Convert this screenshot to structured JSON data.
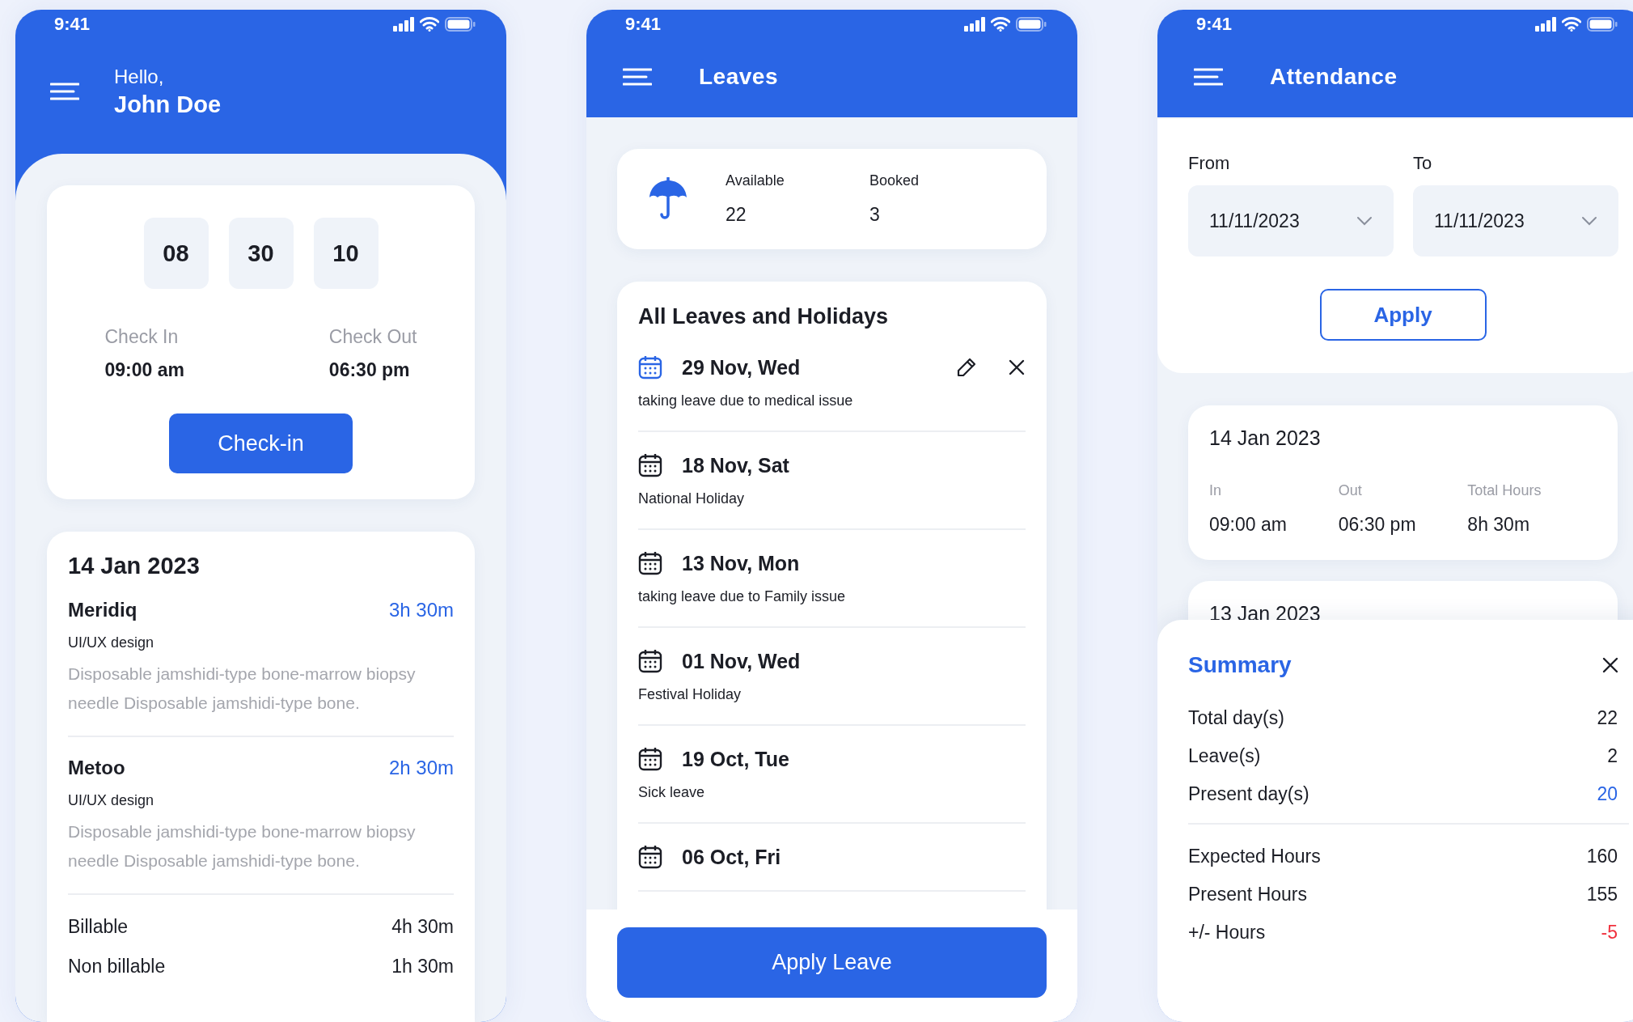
{
  "screens": [
    {
      "kind": "home",
      "status_time": "9:41",
      "greeting": "Hello,",
      "user_name": "John Doe",
      "timer": [
        "08",
        "30",
        "10"
      ],
      "check_in": {
        "label": "Check In",
        "time": "09:00 am"
      },
      "check_out": {
        "label": "Check Out",
        "time": "06:30 pm"
      },
      "button": "Check-in",
      "day": {
        "date": "14 Jan 2023",
        "projects": [
          {
            "name": "Meridiq",
            "hours": "3h 30m",
            "role": "UI/UX design",
            "description": "Disposable jamshidi-type bone-marrow biopsy needle Disposable jamshidi-type bone."
          },
          {
            "name": "Metoo",
            "hours": "2h 30m",
            "role": "UI/UX design",
            "description": "Disposable jamshidi-type bone-marrow biopsy needle Disposable jamshidi-type bone."
          }
        ],
        "totals": [
          {
            "label": "Billable",
            "value": "4h 30m"
          },
          {
            "label": "Non billable",
            "value": "1h 30m"
          }
        ]
      }
    },
    {
      "kind": "leaves",
      "status_time": "9:41",
      "title": "Leaves",
      "balance": [
        {
          "label": "Available",
          "value": "22"
        },
        {
          "label": "Booked",
          "value": "3"
        }
      ],
      "list_title": "All Leaves and Holidays",
      "leaves": [
        {
          "date": "29 Nov, Wed",
          "note": "taking leave due to  medical issue",
          "selected": true
        },
        {
          "date": "18 Nov, Sat",
          "note": "National Holiday",
          "selected": false
        },
        {
          "date": "13 Nov, Mon",
          "note": "taking leave due to  Family issue",
          "selected": false
        },
        {
          "date": "01 Nov, Wed",
          "note": "Festival Holiday",
          "selected": false
        },
        {
          "date": "19 Oct, Tue",
          "note": "Sick leave",
          "selected": false
        },
        {
          "date": "06 Oct, Fri",
          "selected": false
        }
      ],
      "button": "Apply Leave"
    },
    {
      "kind": "attendance",
      "status_time": "9:41",
      "title": "Attendance",
      "from": {
        "label": "From",
        "value": "11/11/2023"
      },
      "to": {
        "label": "To",
        "value": "11/11/2023"
      },
      "button": "Apply",
      "days": [
        {
          "date": "14 Jan 2023",
          "columns": [
            {
              "label": "In",
              "value": "09:00 am"
            },
            {
              "label": "Out",
              "value": "06:30 pm"
            },
            {
              "label": "Total Hours",
              "value": "8h 30m"
            }
          ]
        },
        {
          "date": "13 Jan 2023"
        }
      ],
      "summary": {
        "title": "Summary",
        "groups": [
          [
            {
              "label": "Total day(s)",
              "value": "22",
              "color": "#1b1d25"
            },
            {
              "label": "Leave(s)",
              "value": "2",
              "color": "#1b1d25"
            },
            {
              "label": "Present day(s)",
              "value": "20",
              "color": "#2a65e5"
            }
          ],
          [
            {
              "label": "Expected Hours",
              "value": "160",
              "color": "#1b1d25"
            },
            {
              "label": "Present Hours",
              "value": "155",
              "color": "#1b1d25"
            },
            {
              "label": "+/- Hours",
              "value": "-5",
              "color": "#f0313e"
            }
          ]
        ]
      }
    }
  ]
}
